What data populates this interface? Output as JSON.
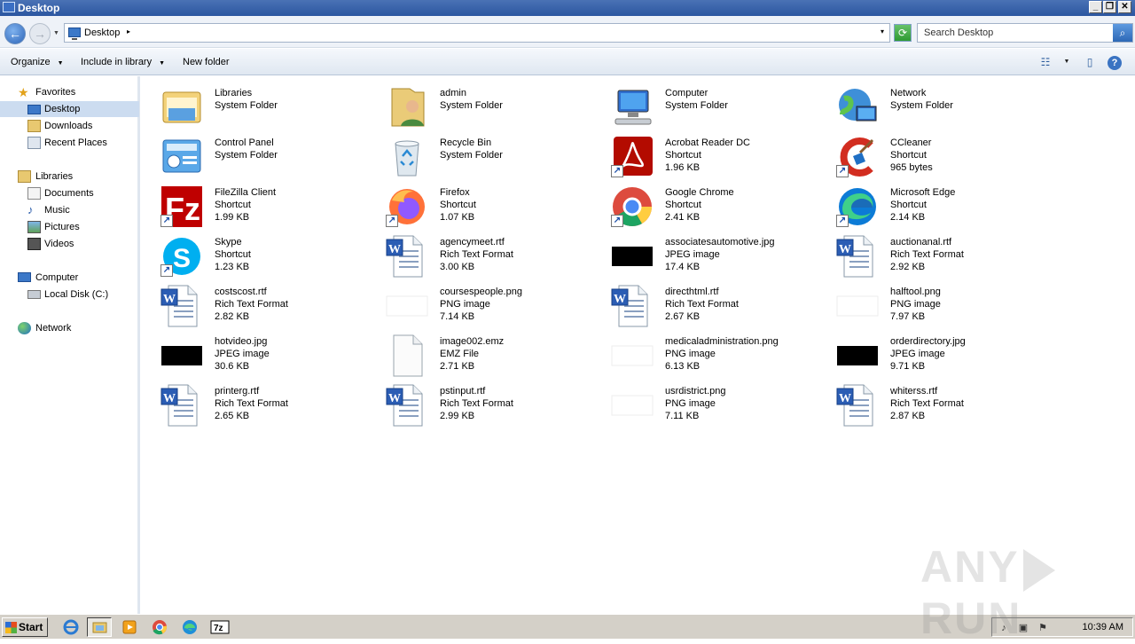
{
  "window": {
    "title": "Desktop",
    "min": "_",
    "max": "❐",
    "close": "✕"
  },
  "address": {
    "path": "Desktop",
    "chevron": "▸",
    "dropdown": "▾"
  },
  "search": {
    "placeholder": "Search Desktop"
  },
  "toolbar": {
    "organize": "Organize",
    "include_in_library": "Include in library",
    "new_folder": "New folder"
  },
  "nav": {
    "favorites": {
      "label": "Favorites",
      "items": [
        "Desktop",
        "Downloads",
        "Recent Places"
      ]
    },
    "libraries": {
      "label": "Libraries",
      "items": [
        "Documents",
        "Music",
        "Pictures",
        "Videos"
      ]
    },
    "computer": {
      "label": "Computer",
      "items": [
        "Local Disk (C:)"
      ]
    },
    "network": {
      "label": "Network"
    }
  },
  "files": [
    {
      "name": "Libraries",
      "type": "System Folder",
      "size": "",
      "icon": "libraries-icon"
    },
    {
      "name": "admin",
      "type": "System Folder",
      "size": "",
      "icon": "user-folder-icon"
    },
    {
      "name": "Computer",
      "type": "System Folder",
      "size": "",
      "icon": "computer-icon"
    },
    {
      "name": "Network",
      "type": "System Folder",
      "size": "",
      "icon": "network-icon"
    },
    {
      "name": "Control Panel",
      "type": "System Folder",
      "size": "",
      "icon": "control-panel-icon"
    },
    {
      "name": "Recycle Bin",
      "type": "System Folder",
      "size": "",
      "icon": "recycle-bin-icon"
    },
    {
      "name": "Acrobat Reader DC",
      "type": "Shortcut",
      "size": "1.96 KB",
      "icon": "acrobat-icon"
    },
    {
      "name": "CCleaner",
      "type": "Shortcut",
      "size": "965 bytes",
      "icon": "ccleaner-icon"
    },
    {
      "name": "FileZilla Client",
      "type": "Shortcut",
      "size": "1.99 KB",
      "icon": "filezilla-icon"
    },
    {
      "name": "Firefox",
      "type": "Shortcut",
      "size": "1.07 KB",
      "icon": "firefox-icon"
    },
    {
      "name": "Google Chrome",
      "type": "Shortcut",
      "size": "2.41 KB",
      "icon": "chrome-icon"
    },
    {
      "name": "Microsoft Edge",
      "type": "Shortcut",
      "size": "2.14 KB",
      "icon": "edge-icon"
    },
    {
      "name": "Skype",
      "type": "Shortcut",
      "size": "1.23 KB",
      "icon": "skype-icon"
    },
    {
      "name": "agencymeet.rtf",
      "type": "Rich Text Format",
      "size": "3.00 KB",
      "icon": "wordpad-doc-icon"
    },
    {
      "name": "associatesautomotive.jpg",
      "type": "JPEG image",
      "size": "17.4 KB",
      "icon": "jpeg-thumbnail-icon"
    },
    {
      "name": "auctionanal.rtf",
      "type": "Rich Text Format",
      "size": "2.92 KB",
      "icon": "wordpad-doc-icon"
    },
    {
      "name": "costscost.rtf",
      "type": "Rich Text Format",
      "size": "2.82 KB",
      "icon": "wordpad-doc-icon"
    },
    {
      "name": "coursespeople.png",
      "type": "PNG image",
      "size": "7.14 KB",
      "icon": "png-thumbnail-icon"
    },
    {
      "name": "directhtml.rtf",
      "type": "Rich Text Format",
      "size": "2.67 KB",
      "icon": "wordpad-doc-icon"
    },
    {
      "name": "halftool.png",
      "type": "PNG image",
      "size": "7.97 KB",
      "icon": "png-thumbnail-icon"
    },
    {
      "name": "hotvideo.jpg",
      "type": "JPEG image",
      "size": "30.6 KB",
      "icon": "jpeg-thumbnail-icon"
    },
    {
      "name": "image002.emz",
      "type": "EMZ File",
      "size": "2.71 KB",
      "icon": "blank-file-icon"
    },
    {
      "name": "medicaladministration.png",
      "type": "PNG image",
      "size": "6.13 KB",
      "icon": "png-thumbnail-icon"
    },
    {
      "name": "orderdirectory.jpg",
      "type": "JPEG image",
      "size": "9.71 KB",
      "icon": "jpeg-thumbnail-icon"
    },
    {
      "name": "printerg.rtf",
      "type": "Rich Text Format",
      "size": "2.65 KB",
      "icon": "wordpad-doc-icon"
    },
    {
      "name": "pstinput.rtf",
      "type": "Rich Text Format",
      "size": "2.99 KB",
      "icon": "wordpad-doc-icon"
    },
    {
      "name": "usrdistrict.png",
      "type": "PNG image",
      "size": "7.11 KB",
      "icon": "png-thumbnail-icon"
    },
    {
      "name": "whiterss.rtf",
      "type": "Rich Text Format",
      "size": "2.87 KB",
      "icon": "wordpad-doc-icon"
    }
  ],
  "taskbar": {
    "start_label": "Start",
    "apps": [
      "internet-explorer-icon",
      "explorer-folder-icon",
      "media-player-icon",
      "chrome-icon",
      "edge-icon",
      "7zip-icon"
    ],
    "clock": "10:39 AM"
  },
  "watermark": {
    "left": "ANY",
    "right": "RUN"
  }
}
